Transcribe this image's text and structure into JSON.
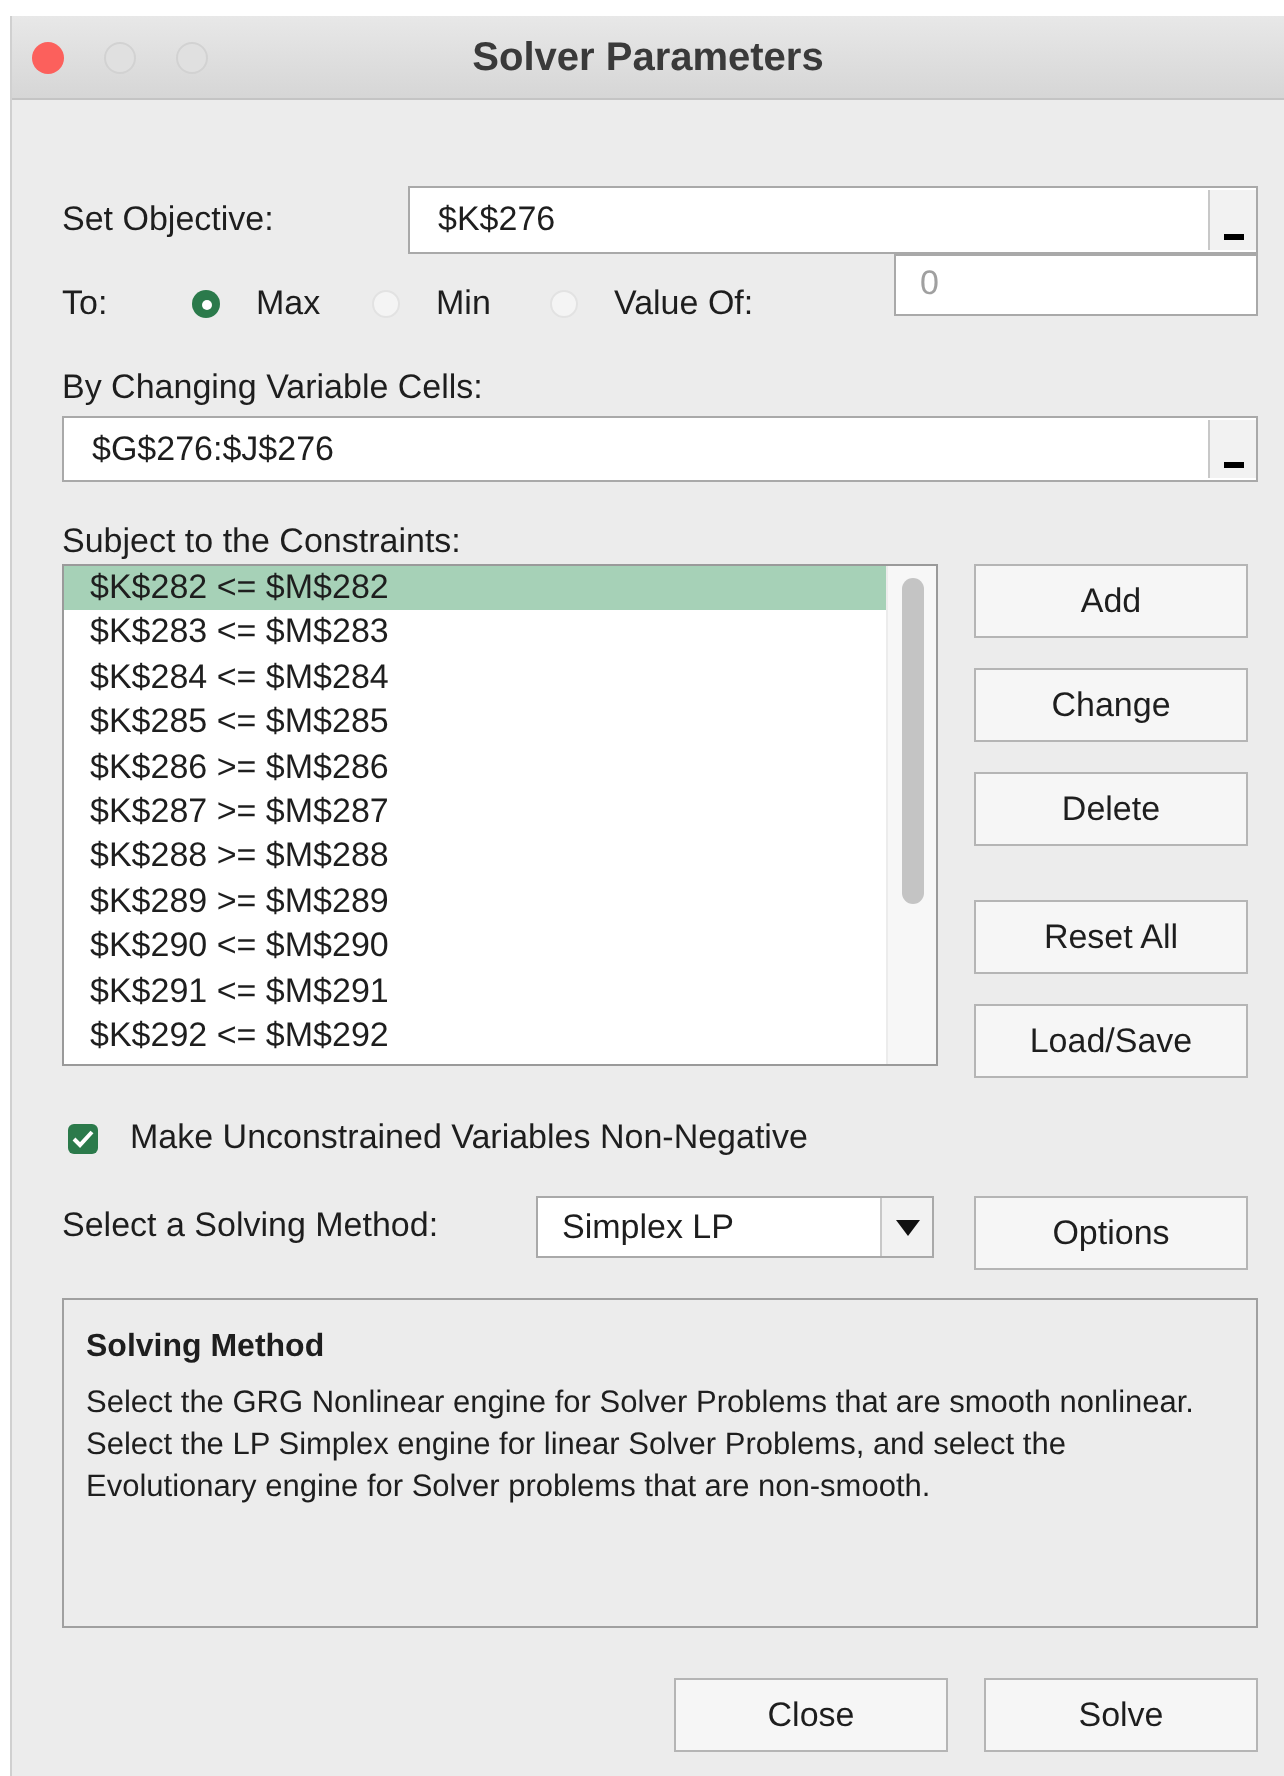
{
  "window": {
    "title": "Solver Parameters"
  },
  "objective": {
    "label": "Set Objective:",
    "value": "$K$276"
  },
  "to": {
    "label": "To:",
    "options": [
      {
        "label": "Max",
        "selected": true
      },
      {
        "label": "Min",
        "selected": false
      },
      {
        "label": "Value Of:",
        "selected": false
      }
    ],
    "value_of": "0"
  },
  "variable_cells": {
    "label": "By Changing Variable Cells:",
    "value": "$G$276:$J$276"
  },
  "constraints": {
    "label": "Subject to the Constraints:",
    "items": [
      {
        "text": "$K$282 <= $M$282",
        "selected": true
      },
      {
        "text": "$K$283 <= $M$283",
        "selected": false
      },
      {
        "text": "$K$284 <= $M$284",
        "selected": false
      },
      {
        "text": "$K$285 <= $M$285",
        "selected": false
      },
      {
        "text": "$K$286 >= $M$286",
        "selected": false
      },
      {
        "text": "$K$287 >= $M$287",
        "selected": false
      },
      {
        "text": "$K$288 >= $M$288",
        "selected": false
      },
      {
        "text": "$K$289 >= $M$289",
        "selected": false
      },
      {
        "text": "$K$290 <= $M$290",
        "selected": false
      },
      {
        "text": "$K$291 <= $M$291",
        "selected": false
      },
      {
        "text": "$K$292 <= $M$292",
        "selected": false
      }
    ]
  },
  "constraint_buttons": [
    "Add",
    "Change",
    "Delete",
    "Reset All",
    "Load/Save"
  ],
  "non_negative": {
    "label": "Make Unconstrained Variables Non-Negative",
    "checked": true
  },
  "method": {
    "label": "Select a Solving Method:",
    "value": "Simplex LP",
    "options_button": "Options"
  },
  "help": {
    "title": "Solving Method",
    "text": "Select the GRG Nonlinear engine for Solver Problems that are smooth nonlinear. Select the LP Simplex engine for linear Solver Problems, and select the Evolutionary engine for Solver problems that are non-smooth."
  },
  "buttons": [
    "Close",
    "Solve"
  ]
}
